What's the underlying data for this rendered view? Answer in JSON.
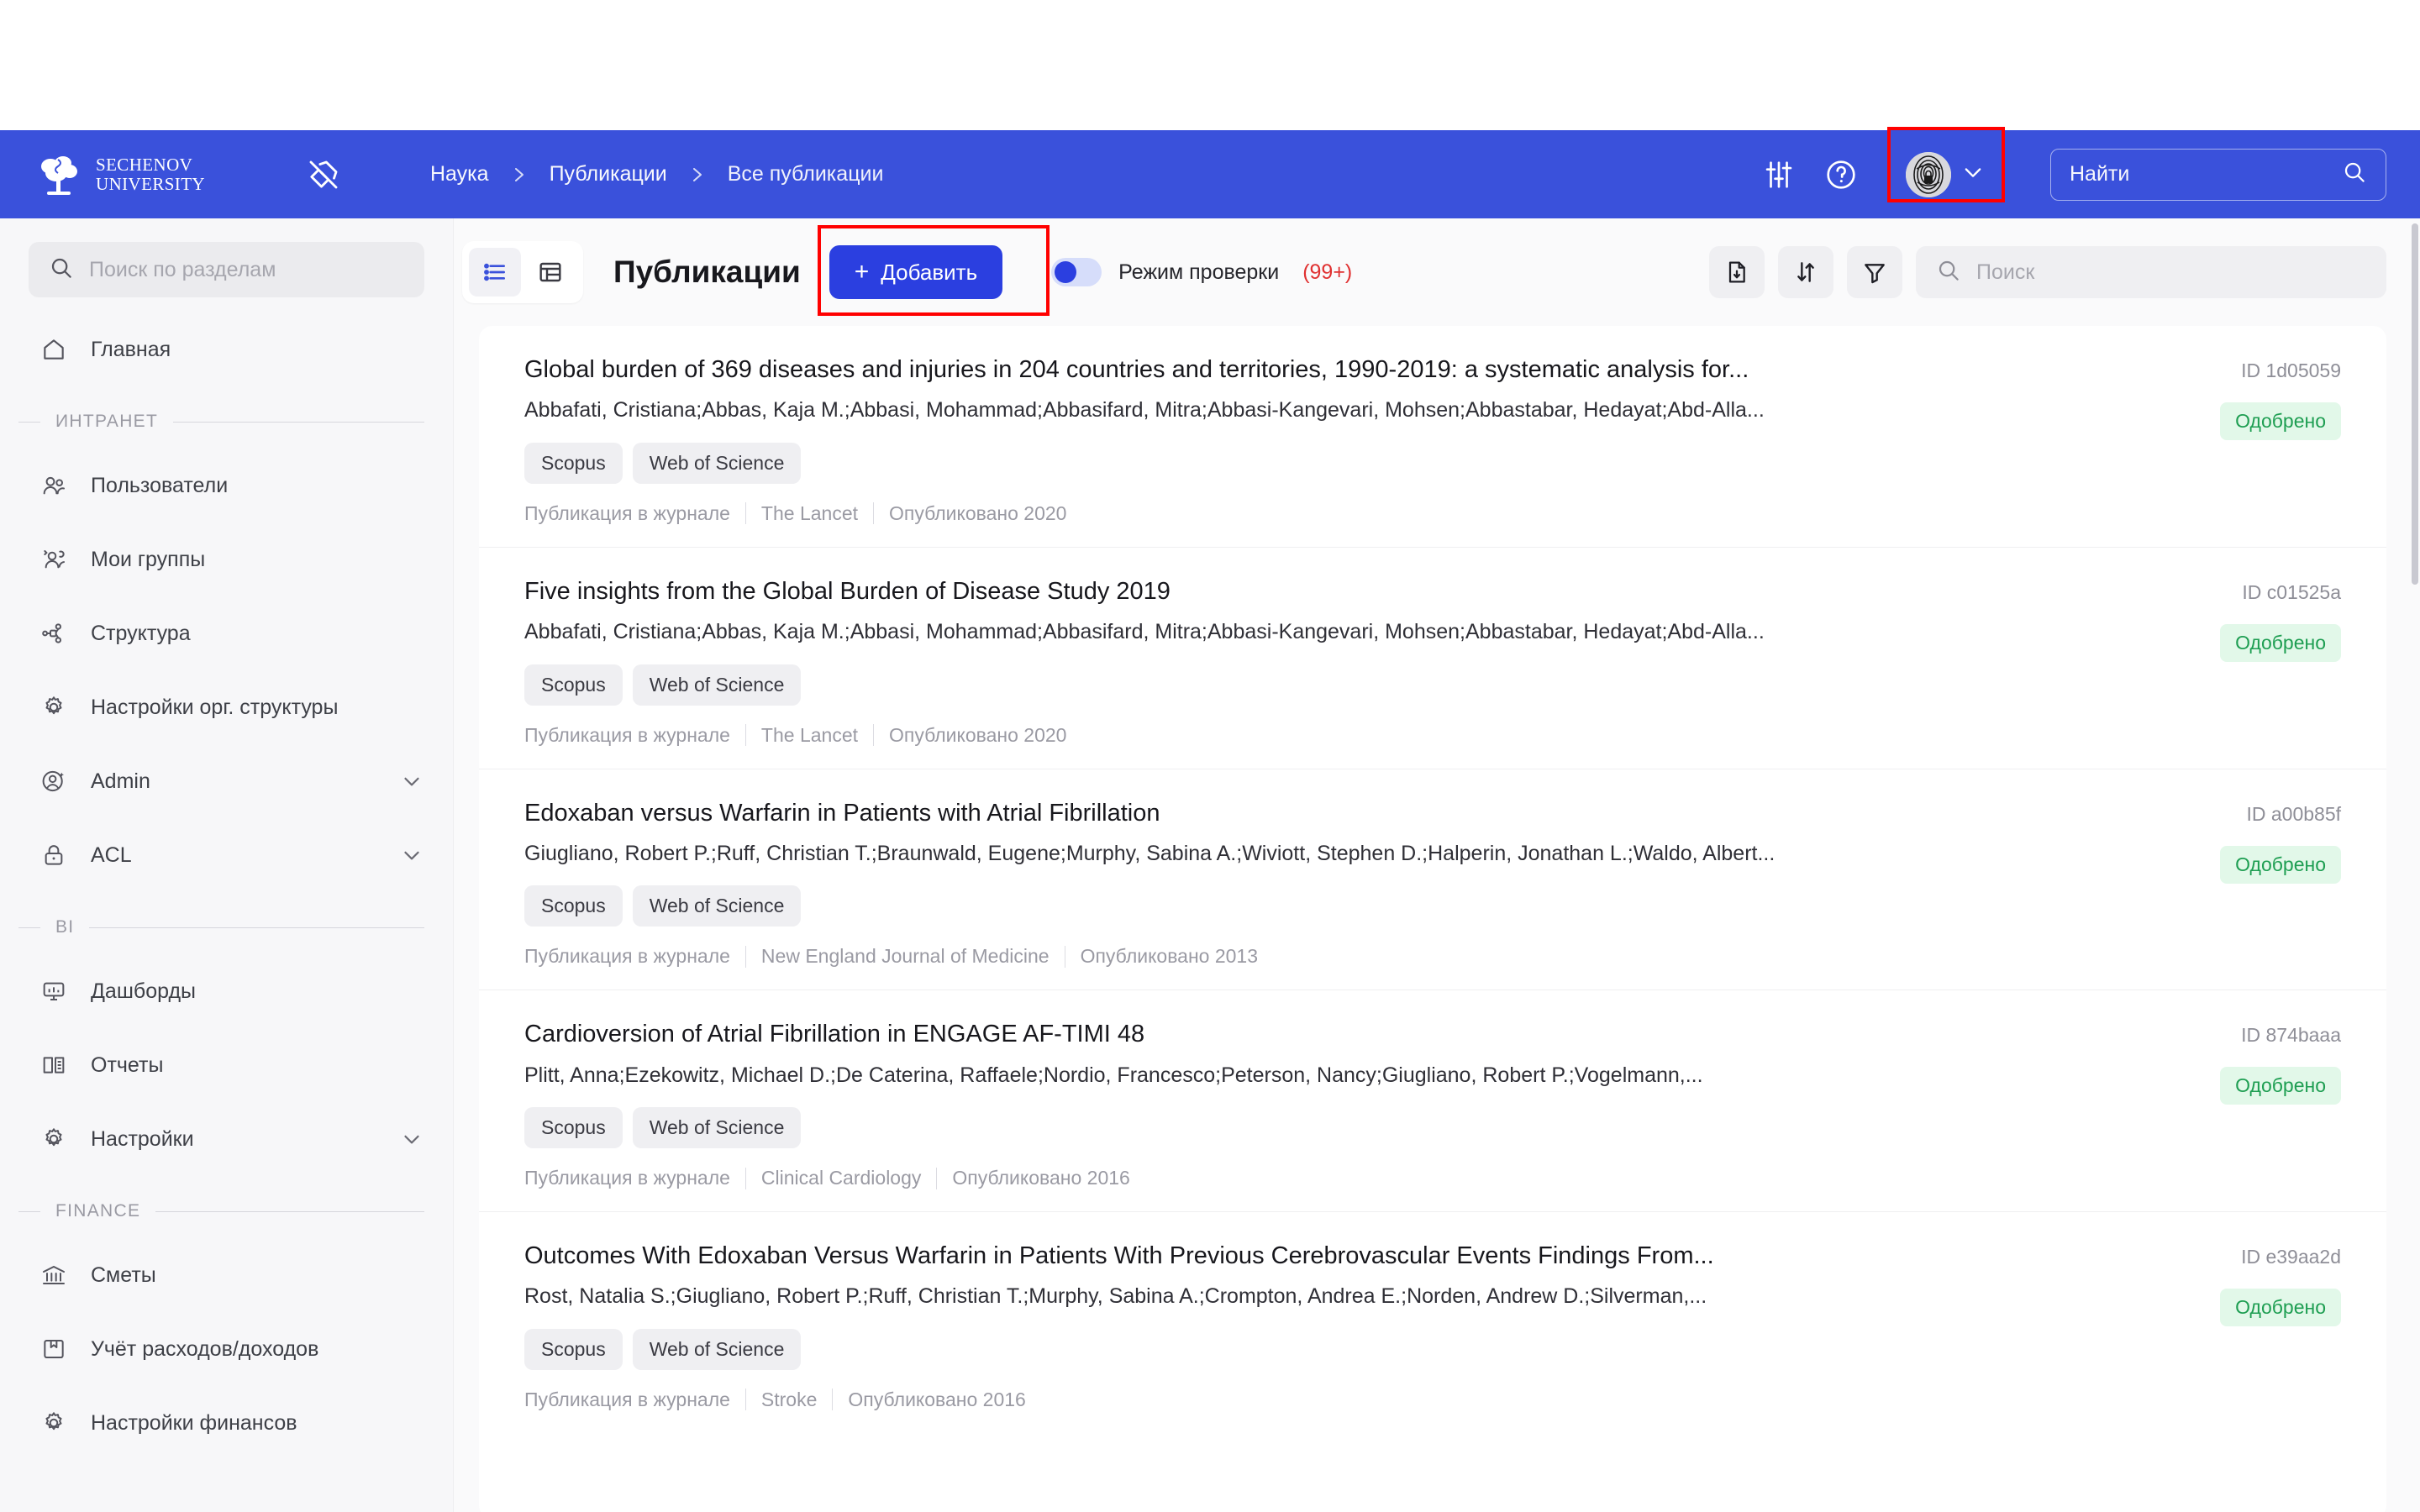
{
  "header": {
    "logo": {
      "line1": "SECHENOV",
      "line2": "UNIVERSITY",
      "icon": "sechenov-tree-logo"
    },
    "pin_icon": "pin-off-icon",
    "breadcrumb": [
      "Наука",
      "Публикации",
      "Все публикации"
    ],
    "settings_icon": "sliders-icon",
    "help_icon": "question-circle-icon",
    "avatar_icon": "fingerprint-avatar",
    "avatar_chevron_icon": "chevron-down-icon",
    "search": {
      "placeholder": "Найти",
      "icon": "search-icon"
    },
    "brand_color": "#3A51DB",
    "annotation_color": "#FF0000"
  },
  "sidebar": {
    "search": {
      "placeholder": "Поиск по разделам",
      "icon": "search-icon"
    },
    "items": [
      {
        "label": "Главная",
        "icon": "home-icon",
        "chevron": false,
        "group": null
      },
      {
        "label": "ИНТРАНЕТ",
        "type": "group"
      },
      {
        "label": "Пользователи",
        "icon": "users-icon",
        "chevron": false
      },
      {
        "label": "Мои группы",
        "icon": "user-group-icon",
        "chevron": false
      },
      {
        "label": "Структура",
        "icon": "org-structure-icon",
        "chevron": false
      },
      {
        "label": "Настройки орг. структуры",
        "icon": "gear-icon",
        "chevron": false
      },
      {
        "label": "Admin",
        "icon": "user-admin-icon",
        "chevron": true
      },
      {
        "label": "ACL",
        "icon": "lock-icon",
        "chevron": true
      },
      {
        "label": "BI",
        "type": "group"
      },
      {
        "label": "Дашборды",
        "icon": "dashboard-icon",
        "chevron": false
      },
      {
        "label": "Отчеты",
        "icon": "report-book-icon",
        "chevron": false
      },
      {
        "label": "Настройки",
        "icon": "gear-icon",
        "chevron": true
      },
      {
        "label": "FINANCE",
        "type": "group"
      },
      {
        "label": "Сметы",
        "icon": "bank-icon",
        "chevron": false
      },
      {
        "label": "Учёт расходов/доходов",
        "icon": "ledger-icon",
        "chevron": false
      },
      {
        "label": "Настройки финансов",
        "icon": "gear-icon",
        "chevron": false
      }
    ]
  },
  "toolbar": {
    "view_list_icon": "list-view-icon",
    "view_table_icon": "table-view-icon",
    "active_view": "list",
    "title": "Публикации",
    "add_label": "Добавить",
    "add_plus": "+",
    "mode_label": "Режим проверки",
    "mode_count": "(99+)",
    "mode_on": false,
    "export_icon": "file-download-icon",
    "sort_icon": "sort-arrows-icon",
    "filter_icon": "funnel-icon",
    "search": {
      "placeholder": "Поиск",
      "icon": "search-icon"
    }
  },
  "publications": {
    "meta_type_label": "Публикация в журнале",
    "published_prefix": "Опубликовано",
    "id_prefix": "ID",
    "status_color_bg": "#E2F8E9",
    "status_color_fg": "#1E9E52",
    "rows": [
      {
        "title": "Global burden of 369 diseases and injuries in 204 countries and territories, 1990-2019: a systematic analysis for...",
        "authors": "Abbafati, Cristiana;Abbas, Kaja M.;Abbasi, Mohammad;Abbasifard, Mitra;Abbasi-Kangevari, Mohsen;Abbastabar, Hedayat;Abd-Alla...",
        "tags": [
          "Scopus",
          "Web of Science"
        ],
        "type": "Публикация в журнале",
        "journal": "The Lancet",
        "published": "Опубликовано 2020",
        "id": "ID 1d05059",
        "status": "Одобрено"
      },
      {
        "title": "Five insights from the Global Burden of Disease Study 2019",
        "authors": "Abbafati, Cristiana;Abbas, Kaja M.;Abbasi, Mohammad;Abbasifard, Mitra;Abbasi-Kangevari, Mohsen;Abbastabar, Hedayat;Abd-Alla...",
        "tags": [
          "Scopus",
          "Web of Science"
        ],
        "type": "Публикация в журнале",
        "journal": "The Lancet",
        "published": "Опубликовано 2020",
        "id": "ID c01525a",
        "status": "Одобрено"
      },
      {
        "title": "Edoxaban versus Warfarin in Patients with Atrial Fibrillation",
        "authors": "Giugliano, Robert P.;Ruff, Christian T.;Braunwald, Eugene;Murphy, Sabina A.;Wiviott, Stephen D.;Halperin, Jonathan L.;Waldo, Albert...",
        "tags": [
          "Scopus",
          "Web of Science"
        ],
        "type": "Публикация в журнале",
        "journal": "New England Journal of Medicine",
        "published": "Опубликовано 2013",
        "id": "ID a00b85f",
        "status": "Одобрено"
      },
      {
        "title": "Cardioversion of Atrial Fibrillation in ENGAGE AF-TIMI 48",
        "authors": "Plitt, Anna;Ezekowitz, Michael D.;De Caterina, Raffaele;Nordio, Francesco;Peterson, Nancy;Giugliano, Robert P.;Vogelmann,...",
        "tags": [
          "Scopus",
          "Web of Science"
        ],
        "type": "Публикация в журнале",
        "journal": "Clinical Cardiology",
        "published": "Опубликовано 2016",
        "id": "ID 874baaa",
        "status": "Одобрено"
      },
      {
        "title": "Outcomes With Edoxaban Versus Warfarin in Patients With Previous Cerebrovascular Events Findings From...",
        "authors": "Rost, Natalia S.;Giugliano, Robert P.;Ruff, Christian T.;Murphy, Sabina A.;Crompton, Andrea E.;Norden, Andrew D.;Silverman,...",
        "tags": [
          "Scopus",
          "Web of Science"
        ],
        "type": "Публикация в журнале",
        "journal": "Stroke",
        "published": "Опубликовано 2016",
        "id": "ID e39aa2d",
        "status": "Одобрено"
      }
    ]
  }
}
